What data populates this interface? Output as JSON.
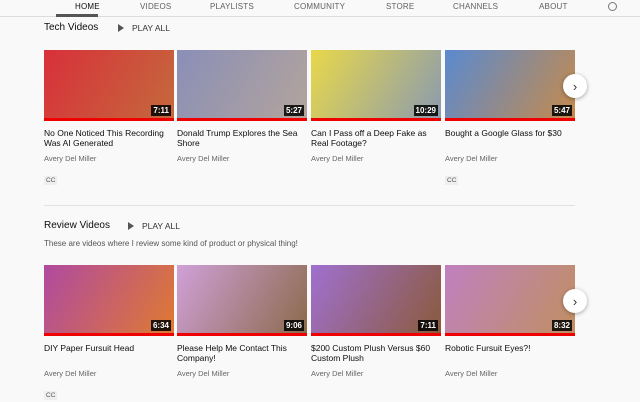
{
  "tabs": [
    "HOME",
    "VIDEOS",
    "PLAYLISTS",
    "COMMUNITY",
    "STORE",
    "CHANNELS",
    "ABOUT"
  ],
  "sections": [
    {
      "title": "Tech Videos",
      "play_all": "PLAY ALL",
      "description": "",
      "videos": [
        {
          "title": "No One Noticed This Recording Was AI Generated",
          "channel": "Avery Del Miller",
          "duration": "7:11",
          "cc": "CC",
          "colors": [
            "#d8303a",
            "#c46a3c"
          ]
        },
        {
          "title": "Donald Trump Explores the Sea Shore",
          "channel": "Avery Del Miller",
          "duration": "5:27",
          "cc": "",
          "colors": [
            "#8a8fb8",
            "#b3a49c"
          ]
        },
        {
          "title": "Can I Pass off a Deep Fake as Real Footage?",
          "channel": "Avery Del Miller",
          "duration": "10:29",
          "cc": "",
          "colors": [
            "#e8d84a",
            "#8a9ab0"
          ]
        },
        {
          "title": "Bought a Google Glass for $30",
          "channel": "Avery Del Miller",
          "duration": "5:47",
          "cc": "CC",
          "colors": [
            "#5a8ad0",
            "#c78a4a"
          ]
        }
      ]
    },
    {
      "title": "Review Videos",
      "play_all": "PLAY ALL",
      "description": "These are videos where I review some kind of product or physical thing!",
      "videos": [
        {
          "title": "DIY Paper Fursuit Head",
          "channel": "Avery Del Miller",
          "duration": "6:34",
          "cc": "CC",
          "colors": [
            "#b04aa0",
            "#e07a30"
          ]
        },
        {
          "title": "Please Help Me Contact This Company!",
          "channel": "Avery Del Miller",
          "duration": "9:06",
          "cc": "",
          "colors": [
            "#d0a0d8",
            "#8a6a4a"
          ]
        },
        {
          "title": "$200 Custom Plush Versus $60 Custom Plush",
          "channel": "Avery Del Miller",
          "duration": "7:11",
          "cc": "",
          "colors": [
            "#a070d0",
            "#8a5a3a"
          ]
        },
        {
          "title": "Robotic Fursuit Eyes?!",
          "channel": "Avery Del Miller",
          "duration": "8:32",
          "cc": "",
          "colors": [
            "#c080c0",
            "#c09060"
          ]
        }
      ]
    }
  ],
  "icons": {
    "search": "search-icon",
    "next": "chevron-right-icon",
    "play": "play-icon"
  },
  "accent": "#ee0000"
}
